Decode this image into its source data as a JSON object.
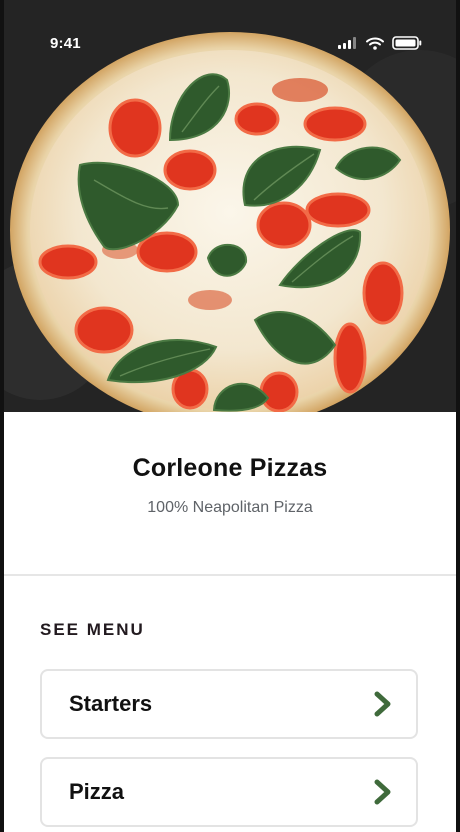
{
  "status": {
    "time": "9:41",
    "icons": [
      "cellular-signal-icon",
      "wifi-icon",
      "battery-icon"
    ]
  },
  "hero": {
    "image": "margherita-pizza-photo"
  },
  "restaurant": {
    "name": "Corleone Pizzas",
    "tagline": "100% Neapolitan Pizza"
  },
  "menu": {
    "heading": "SEE MENU",
    "items": [
      {
        "label": "Starters",
        "icon": "chevron-right-icon"
      },
      {
        "label": "Pizza",
        "icon": "chevron-right-icon"
      }
    ]
  },
  "colors": {
    "accent": "#3f6a3b",
    "text": "#111111",
    "muted": "#5f6368",
    "border": "#e3e3e3"
  }
}
